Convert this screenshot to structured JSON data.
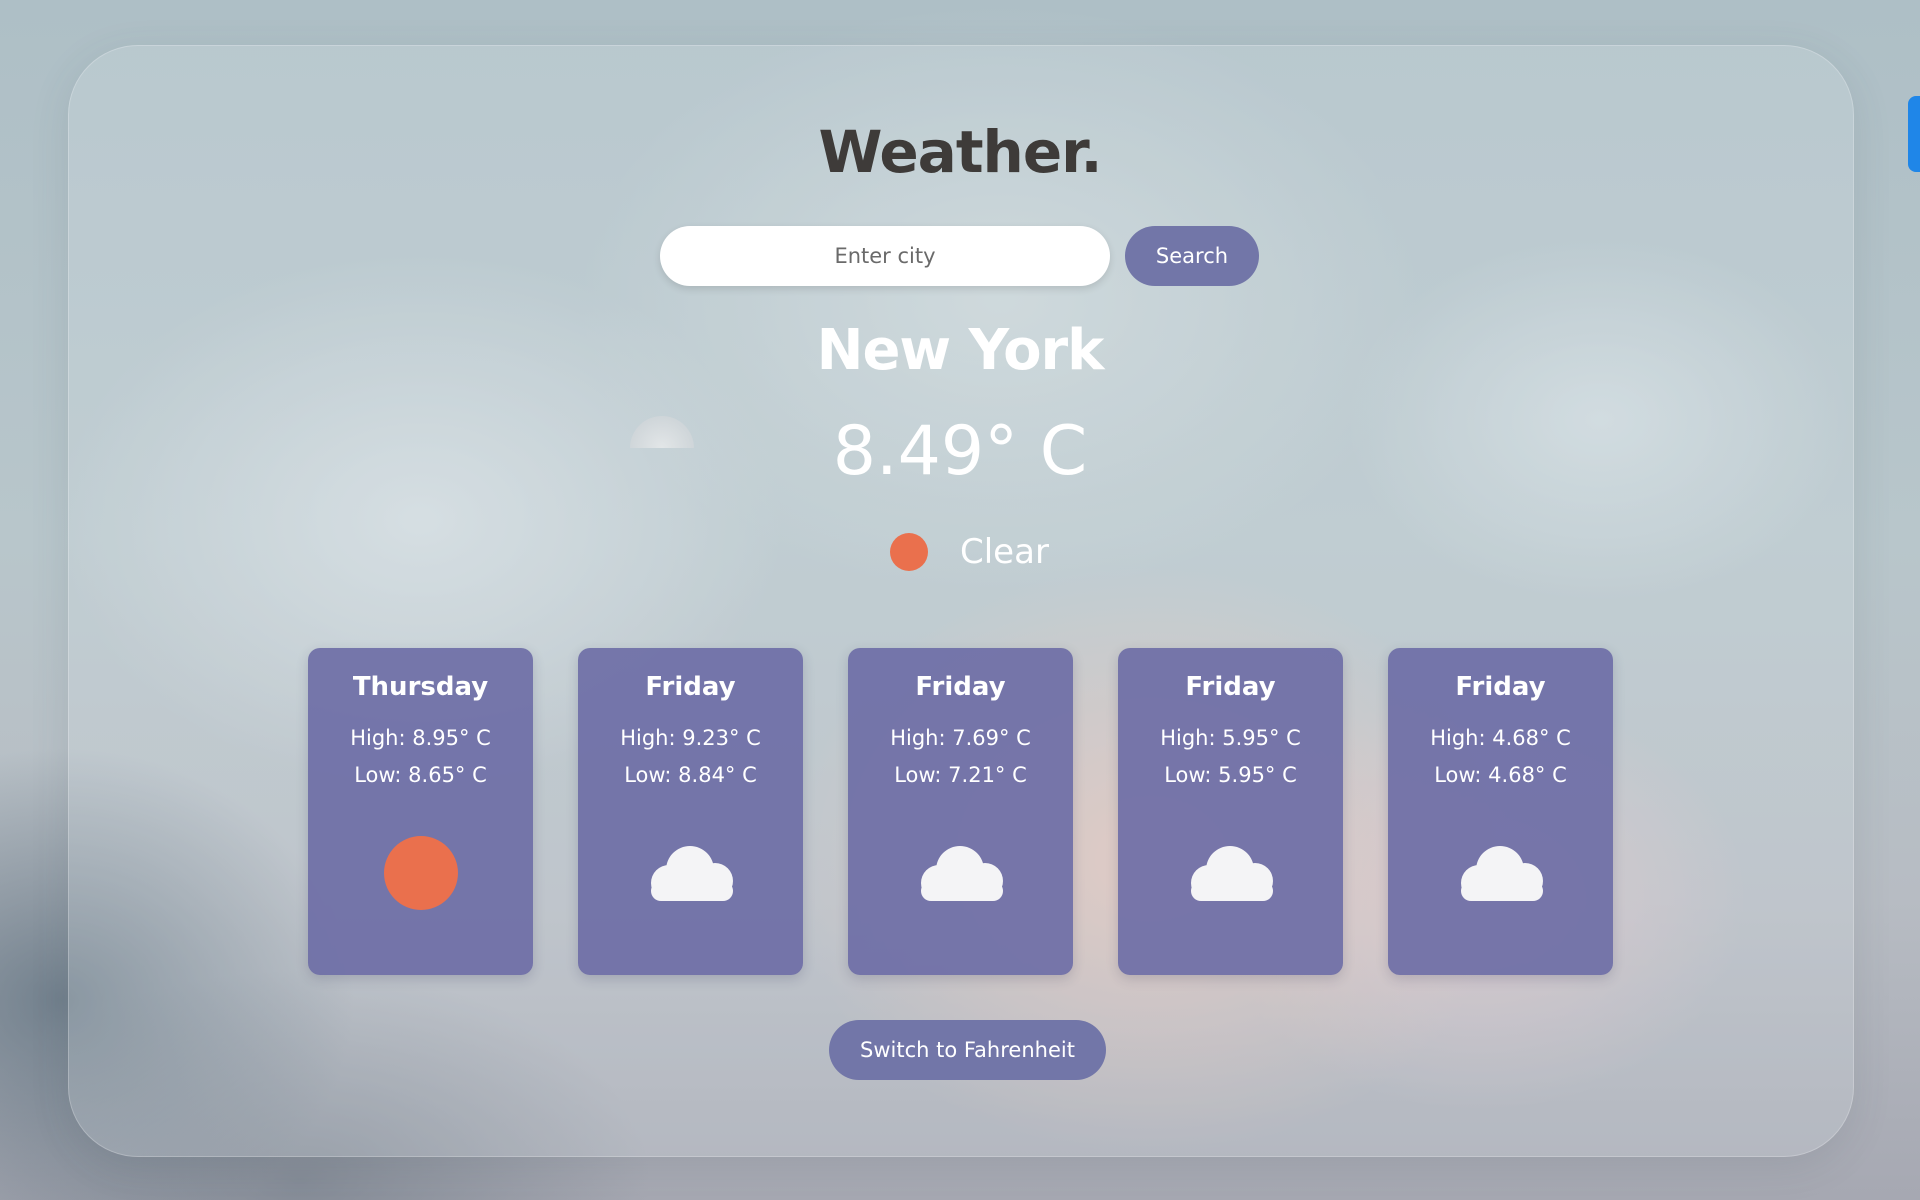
{
  "app": {
    "title": "Weather."
  },
  "search": {
    "placeholder": "Enter city",
    "value": "",
    "button_label": "Search"
  },
  "current": {
    "city": "New York",
    "temperature": "8.49° C",
    "condition": "Clear",
    "condition_icon": "sun-icon"
  },
  "forecast": [
    {
      "day": "Thursday",
      "high": "High: 8.95° C",
      "low": "Low: 8.65° C",
      "icon": "sun-icon"
    },
    {
      "day": "Friday",
      "high": "High: 9.23° C",
      "low": "Low: 8.84° C",
      "icon": "cloud-icon"
    },
    {
      "day": "Friday",
      "high": "High: 7.69° C",
      "low": "Low: 7.21° C",
      "icon": "cloud-icon"
    },
    {
      "day": "Friday",
      "high": "High: 5.95° C",
      "low": "Low: 5.95° C",
      "icon": "cloud-icon"
    },
    {
      "day": "Friday",
      "high": "High: 4.68° C",
      "low": "Low: 4.68° C",
      "icon": "cloud-icon"
    }
  ],
  "unit_toggle": {
    "label": "Switch to Fahrenheit"
  },
  "colors": {
    "accent": "#7276a8",
    "card": "#6c6ca5",
    "sun": "#ea704d",
    "title": "#3e3b39"
  }
}
